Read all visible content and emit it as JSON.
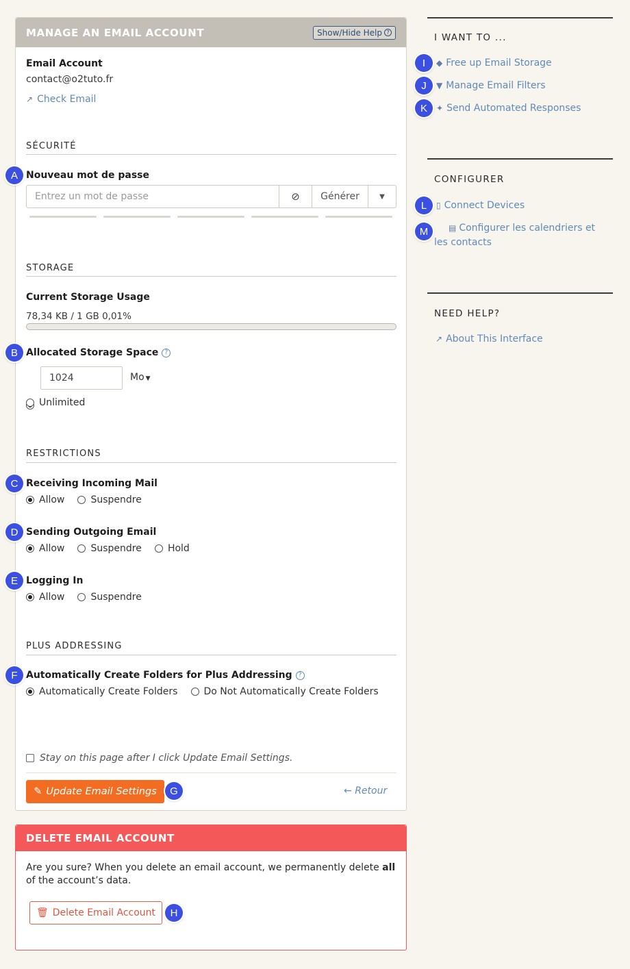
{
  "main_panel": {
    "title": "MANAGE AN EMAIL ACCOUNT",
    "help_button": "Show/Hide Help",
    "email_account_label": "Email Account",
    "email_account_value": "contact@o2tuto.fr",
    "check_email_link": "Check Email"
  },
  "security": {
    "section_title": "SÉCURITÉ",
    "password_label": "Nouveau mot de passe",
    "password_placeholder": "Entrez un mot de passe",
    "generate_button": "Générer"
  },
  "storage": {
    "section_title": "STORAGE",
    "current_usage_label": "Current Storage Usage",
    "current_usage_value": "78,34 KB / 1 GB 0,01%",
    "usage_percent": 0.01,
    "allocated_label": "Allocated Storage Space",
    "allocated_value": "1024",
    "unit": "Mo",
    "unlimited_label": "Unlimited"
  },
  "restrictions": {
    "section_title": "RESTRICTIONS",
    "receiving_label": "Receiving Incoming Mail",
    "sending_label": "Sending Outgoing Email",
    "logging_label": "Logging In",
    "allow": "Allow",
    "suspend": "Suspendre",
    "hold": "Hold"
  },
  "plus_addressing": {
    "section_title": "PLUS ADDRESSING",
    "label": "Automatically Create Folders for Plus Addressing",
    "option_auto": "Automatically Create Folders",
    "option_no_auto": "Do Not Automatically Create Folders"
  },
  "footer": {
    "stay_on_page": "Stay on this page after I click Update Email Settings.",
    "update_button": "Update Email Settings",
    "back_link": "Retour"
  },
  "delete_panel": {
    "title": "DELETE EMAIL ACCOUNT",
    "text_before": "Are you sure? When you delete an email account, we permanently delete ",
    "text_bold": "all",
    "text_after": " of the account’s data.",
    "delete_button": "Delete Email Account"
  },
  "sidebar": {
    "want_title": "I WANT TO ...",
    "want_links": [
      "Free up Email Storage",
      "Manage Email Filters",
      "Send Automated Responses"
    ],
    "configure_title": "CONFIGURER",
    "configure_links": [
      "Connect Devices",
      "Configurer les calendriers et les contacts"
    ],
    "help_title": "NEED HELP?",
    "help_link": "About This Interface"
  },
  "markers": [
    "A",
    "B",
    "C",
    "D",
    "E",
    "F",
    "G",
    "H",
    "I",
    "J",
    "K",
    "L",
    "M"
  ],
  "colors": {
    "accent_orange": "#f26d21",
    "danger_red": "#f55858",
    "link_blue": "#5f8ab8",
    "marker_blue": "#3b4fe0"
  }
}
